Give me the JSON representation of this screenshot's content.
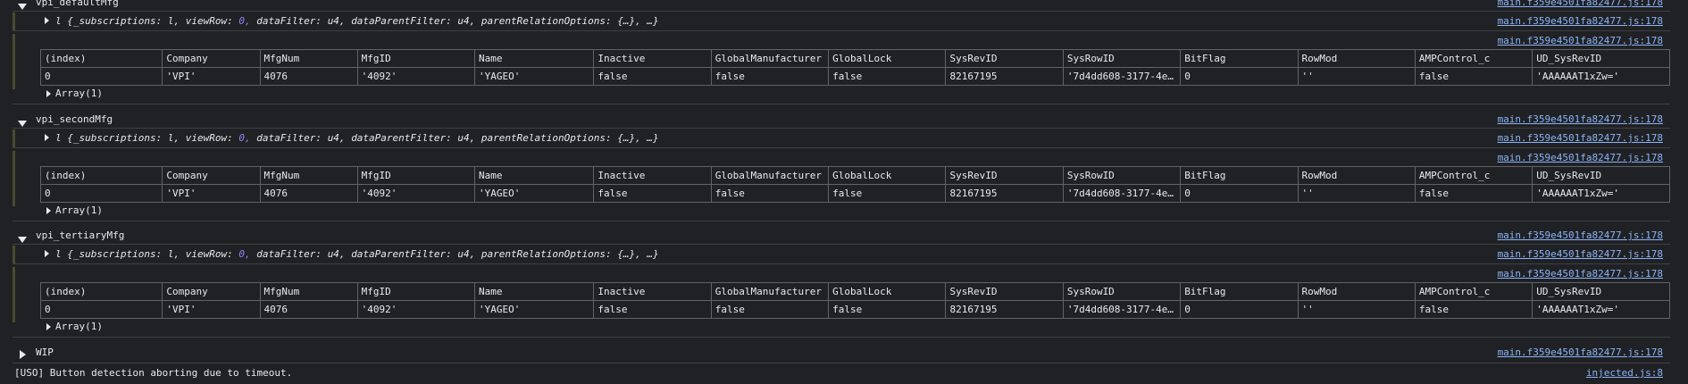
{
  "sections": [
    {
      "name": "vpi_defaultMfg",
      "link_label": "main.f359e4501fa82477.js:178",
      "obj_link": "main.f359e4501fa82477.js:178",
      "table_link": "main.f359e4501fa82477.js:178",
      "array_label": "Array(1)"
    },
    {
      "name": "vpi_secondMfg",
      "link_label": "main.f359e4501fa82477.js:178",
      "obj_link": "main.f359e4501fa82477.js:178",
      "table_link": "main.f359e4501fa82477.js:178",
      "array_label": "Array(1)"
    },
    {
      "name": "vpi_tertiaryMfg",
      "link_label": "main.f359e4501fa82477.js:178",
      "obj_link": "main.f359e4501fa82477.js:178",
      "table_link": "main.f359e4501fa82477.js:178",
      "array_label": "Array(1)"
    }
  ],
  "object_preview": {
    "prefix": "l",
    "open": "{",
    "parts": [
      {
        "key": "_subscriptions",
        "val": "l",
        "type": "plain"
      },
      {
        "key": "viewRow",
        "val": "0",
        "type": "num"
      },
      {
        "key": "dataFilter",
        "val": "u4",
        "type": "plain"
      },
      {
        "key": "dataParentFilter",
        "val": "u4",
        "type": "plain"
      },
      {
        "key": "parentRelationOptions",
        "val": "{…}",
        "type": "plain"
      }
    ],
    "tail": "…}"
  },
  "table": {
    "columns": [
      "(index)",
      "Company",
      "MfgNum",
      "MfgID",
      "Name",
      "Inactive",
      "GlobalManufacturer",
      "GlobalLock",
      "SysRevID",
      "SysRowID",
      "BitFlag",
      "RowMod",
      "AMPControl_c",
      "UD_SysRevID"
    ],
    "row": [
      {
        "v": "0",
        "t": "plain"
      },
      {
        "v": "'VPI'",
        "t": "str"
      },
      {
        "v": "4076",
        "t": "num"
      },
      {
        "v": "'4092'",
        "t": "str"
      },
      {
        "v": "'YAGEO'",
        "t": "str"
      },
      {
        "v": "false",
        "t": "bool"
      },
      {
        "v": "false",
        "t": "bool"
      },
      {
        "v": "false",
        "t": "bool"
      },
      {
        "v": "82167195",
        "t": "num"
      },
      {
        "v": "'7d4dd608-3177-4e…",
        "t": "str"
      },
      {
        "v": "0",
        "t": "num"
      },
      {
        "v": "''",
        "t": "str"
      },
      {
        "v": "false",
        "t": "bool"
      },
      {
        "v": "'AAAAAAT1xZw='",
        "t": "str"
      }
    ]
  },
  "wip": {
    "label": "WIP",
    "link": "main.f359e4501fa82477.js:178"
  },
  "uso": {
    "message": "[USO] Button detection aborting due to timeout.",
    "link": "injected.js:8"
  }
}
